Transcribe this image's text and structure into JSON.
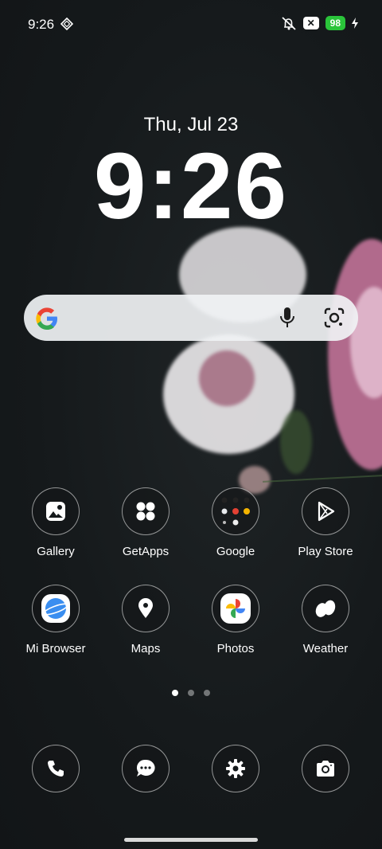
{
  "status": {
    "time": "9:26",
    "battery": "98",
    "icons": [
      "hotspot-diamond-icon",
      "mute-icon",
      "x-notification-icon",
      "charging-bolt-icon"
    ]
  },
  "lockscreen": {
    "date": "Thu, Jul 23",
    "clock": "9:26"
  },
  "search": {
    "icons": [
      "google-g-icon",
      "microphone-icon",
      "google-lens-icon"
    ]
  },
  "apps": [
    {
      "label": "Gallery",
      "icon": "gallery-icon"
    },
    {
      "label": "GetApps",
      "icon": "getapps-icon"
    },
    {
      "label": "Google",
      "icon": "google-folder-icon"
    },
    {
      "label": "Play Store",
      "icon": "play-store-icon"
    },
    {
      "label": "Mi Browser",
      "icon": "mi-browser-icon"
    },
    {
      "label": "Maps",
      "icon": "maps-icon"
    },
    {
      "label": "Photos",
      "icon": "photos-icon"
    },
    {
      "label": "Weather",
      "icon": "weather-icon"
    }
  ],
  "pages": {
    "count": 3,
    "active": 1
  },
  "dock": [
    {
      "icon": "phone-icon"
    },
    {
      "icon": "messages-icon"
    },
    {
      "icon": "settings-icon"
    },
    {
      "icon": "camera-icon"
    }
  ]
}
